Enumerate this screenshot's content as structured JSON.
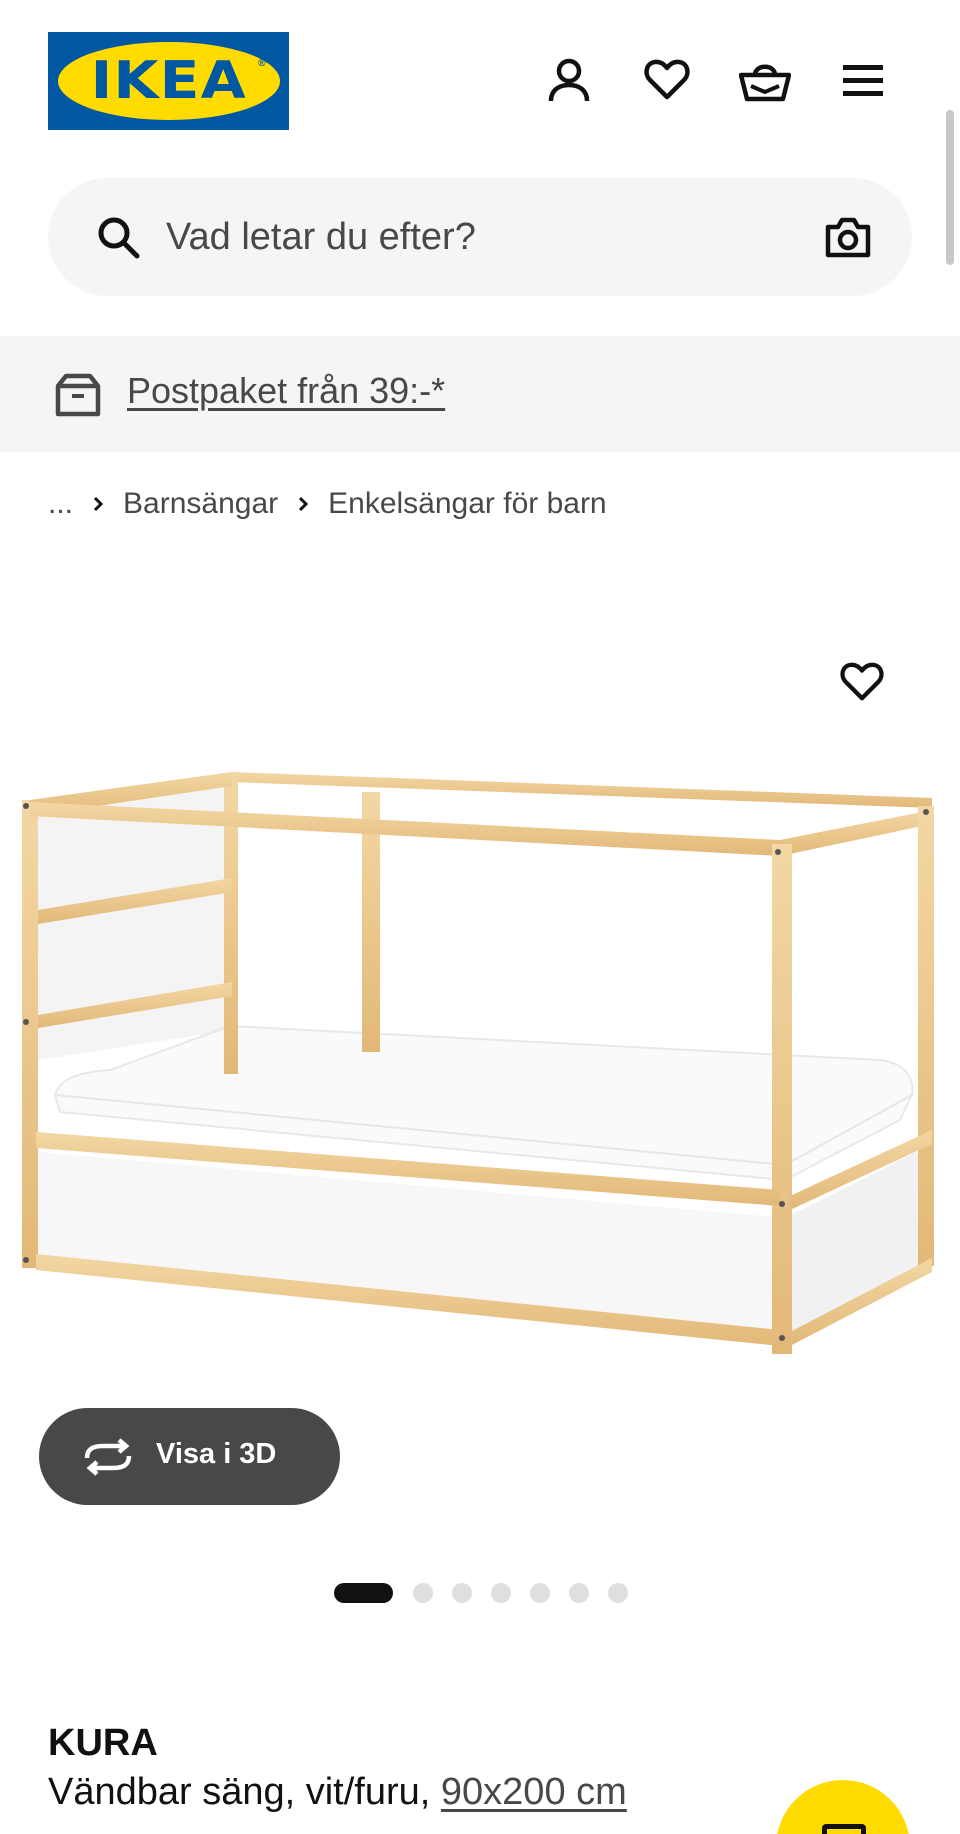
{
  "brand": {
    "logo_text": "IKEA",
    "logo_registered": "®",
    "colors": {
      "blue": "#0058a3",
      "yellow": "#ffdb00"
    }
  },
  "header": {
    "icons": [
      "user-icon",
      "heart-icon",
      "basket-icon",
      "menu-icon"
    ]
  },
  "search": {
    "placeholder": "Vad letar du efter?",
    "value": "",
    "left_icon": "search-icon",
    "right_icon": "camera-icon"
  },
  "promo": {
    "icon": "parcel-icon",
    "text": "Postpaket från 39:-*"
  },
  "breadcrumb": {
    "items": [
      "...",
      "Barnsängar",
      "Enkelsängar för barn"
    ],
    "separator_icon": "chevron-right-icon"
  },
  "gallery": {
    "favorite_icon": "heart-icon",
    "view_3d_label": "Visa i 3D",
    "view_3d_icon": "rotate-icon",
    "dot_count": 7,
    "active_dot_index": 0
  },
  "product": {
    "name": "KURA",
    "description": "Vändbar säng, vit/furu, ",
    "size": "90x200 cm"
  },
  "chat": {
    "icon": "chat-icon"
  }
}
